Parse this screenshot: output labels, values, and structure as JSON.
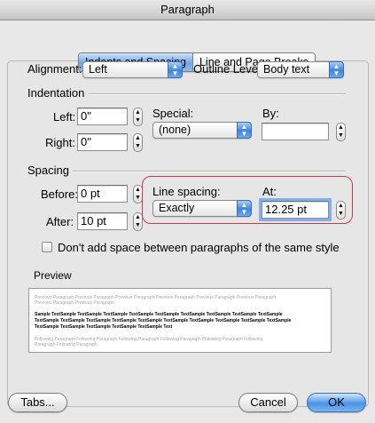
{
  "window": {
    "title": "Paragraph"
  },
  "tabs": [
    {
      "label": "Indents and Spacing",
      "active": true
    },
    {
      "label": "Line and Page Breaks",
      "active": false
    }
  ],
  "general": {
    "alignment_label": "Alignment:",
    "alignment_value": "Left",
    "outline_label": "Outline Level:",
    "outline_value": "Body text"
  },
  "indentation": {
    "heading": "Indentation",
    "left_label": "Left:",
    "left_value": "0\"",
    "right_label": "Right:",
    "right_value": "0\"",
    "special_label": "Special:",
    "special_value": "(none)",
    "by_label": "By:",
    "by_value": ""
  },
  "spacing": {
    "heading": "Spacing",
    "before_label": "Before:",
    "before_value": "0 pt",
    "after_label": "After:",
    "after_value": "10 pt",
    "line_spacing_label": "Line spacing:",
    "line_spacing_value": "Exactly",
    "at_label": "At:",
    "at_value": "12.25 pt",
    "dont_add_label": "Don't add space between paragraphs of the same style",
    "dont_add_checked": false
  },
  "preview": {
    "heading": "Preview",
    "previous_lines": [
      "Previous Paragraph Previous Paragraph Previous Paragraph Previous Paragraph Previous Paragraph Previous Paragraph",
      "Previous Paragraph Previous Paragraph"
    ],
    "sample_lines": [
      "Sample TextSample TextSample TextSample TextSample TextSample TextSample TextSample TextSample TextSample",
      "TextSample TextSample TextSample TextSample TextSample TextSample TextSample TextSample TextSample TextSample",
      "TextSample TextSample TextSample TextSample TextSample Text"
    ],
    "following_lines": [
      "Following Paragraph Following Paragraph Following Paragraph Following Paragraph Following Paragraph Following",
      "Paragraph Following Paragraph"
    ]
  },
  "buttons": {
    "tabs": "Tabs...",
    "cancel": "Cancel",
    "ok": "OK"
  },
  "colors": {
    "accent": "#3d86e0",
    "highlight": "#d1384d"
  }
}
